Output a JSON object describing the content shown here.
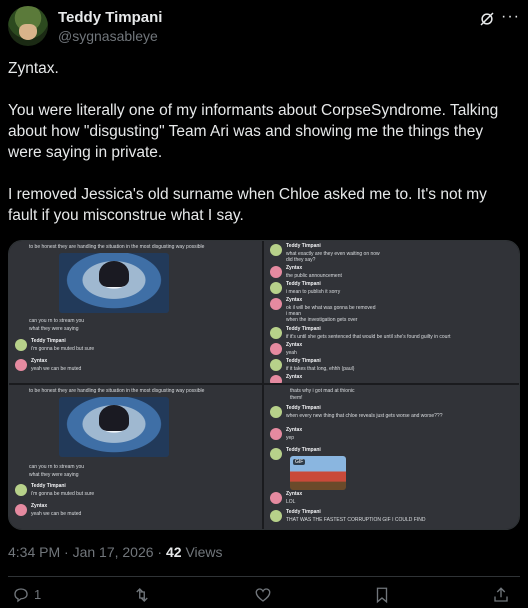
{
  "author": {
    "name": "Teddy Timpani",
    "handle": "@sygnasableye"
  },
  "tweet_text": "Zyntax.\n\nYou were literally one of my informants about CorpseSyndrome. Talking about how \"disgusting\" Team Ari was and showing me the things they were saying in private.\n\nI removed Jessica's old surname when Chloe asked me to. It's not my fault if you misconstrue what I say.",
  "icons": {
    "grok": "grok-icon",
    "more": "more-icon",
    "reply": "reply-icon",
    "repost": "repost-icon",
    "like": "heart-icon",
    "bookmark": "bookmark-icon",
    "share": "share-icon"
  },
  "panel1": {
    "top_line": "to be honest they are handling the situation in the most disgusting way possible",
    "lines": [
      "can you rn to stream you",
      "what they were saying"
    ],
    "messages": [
      {
        "user": "Teddy Timpani",
        "body": "i'm gonna be muted but sure",
        "color": "#b7d18a"
      },
      {
        "user": "Zyntax",
        "body": "yeah we can be muted",
        "color": "#e58aa0"
      }
    ]
  },
  "panel2": {
    "messages": [
      {
        "user": "Teddy Timpani",
        "body": "what exactly are they even waiting on now",
        "extra": "did they say?",
        "color": "#b7d18a"
      },
      {
        "user": "Zyntax",
        "body": "the public announcement",
        "color": "#e58aa0"
      },
      {
        "user": "Teddy Timpani",
        "body": "i mean to publish it sorry",
        "color": "#b7d18a"
      },
      {
        "user": "Zyntax",
        "body": "ok il will be what was gonna be removed",
        "extra": "i mean",
        "extra2": "when the investigation gets over",
        "color": "#e58aa0"
      },
      {
        "user": "Teddy Timpani",
        "body": "if it's until she gets sentenced that would be until she's found guilty in court",
        "color": "#b7d18a"
      },
      {
        "user": "Zyntax",
        "body": "yeah",
        "color": "#e58aa0"
      },
      {
        "user": "Teddy Timpani",
        "body": "if it takes that long, ehhh (paul)",
        "color": "#b7d18a"
      },
      {
        "user": "Zyntax",
        "body": "",
        "color": "#e58aa0"
      }
    ]
  },
  "panel3": {
    "top_line": "to be honest they are handling the situation in the most disgusting way possible",
    "lines": [
      "can you rn to stream you",
      "what they were saying"
    ],
    "messages": [
      {
        "user": "Teddy Timpani",
        "body": "i'm gonna be muted but sure",
        "color": "#b7d18a"
      },
      {
        "user": "Zyntax",
        "body": "yeah we can be muted",
        "color": "#e58aa0"
      }
    ]
  },
  "panel4": {
    "top_lines": [
      "thats why i got mad at thionic",
      "them!"
    ],
    "messages": [
      {
        "user": "Teddy Timpani",
        "body": "when every new thing that chloe reveals just gets worse and worse???",
        "color": "#b7d18a"
      },
      {
        "user": "Zyntax",
        "body": "yep",
        "color": "#e58aa0"
      },
      {
        "user": "Teddy Timpani",
        "body": "",
        "color": "#b7d18a"
      },
      {
        "user": "Zyntax",
        "body": "LOL",
        "color": "#e58aa0"
      },
      {
        "user": "Teddy Timpani",
        "body": "THAT WAS THE FASTEST CORRUPTION GIF I COULD FIND",
        "color": "#b7d18a"
      }
    ],
    "gif_label": "GIF"
  },
  "meta": {
    "time": "4:34 PM · Jan 17, 2026 · ",
    "views_count": "42",
    "views_label": " Views"
  },
  "actions": {
    "replies": "1"
  }
}
